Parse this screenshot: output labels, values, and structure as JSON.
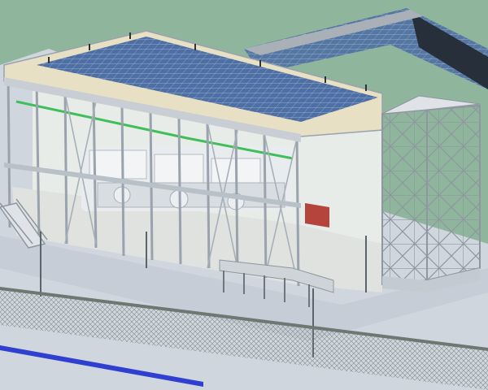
{
  "scene": {
    "kind": "3D BIM render of an industrial power-plant building",
    "colors": {
      "ground": "#8fb59c",
      "road": "#cfd6de",
      "steel": "#c9ced4",
      "beam": "#9aa3ad",
      "roof_frame": "#e8e0c4",
      "solar_panel": "#4d6fa3",
      "wall_panel": "#e3e6e3",
      "floor": "#dfe2df",
      "equipment": "#e9ecef",
      "red_box": "#b5453c",
      "fence_mesh": "#8c948f",
      "blue_line": "#2f3fd0",
      "green_duct": "#3fbf5a"
    },
    "icons": [
      "stair-icon",
      "tower-icon",
      "solar-array-icon",
      "fence-icon",
      "lamp-post-icon"
    ]
  }
}
